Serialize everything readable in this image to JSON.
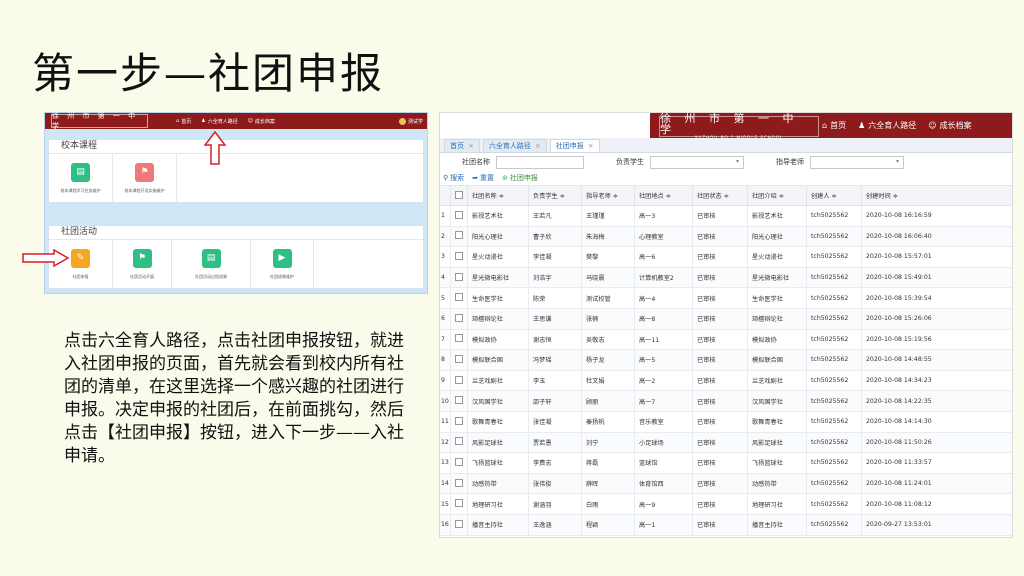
{
  "slide": {
    "title": "第一步—社团申报",
    "paragraph": "点击六全育人路径，点击社团申报按钮，就进入社团申报的页面，首先就会看到校内所有社团的清单，在这里选择一个感兴趣的社团进行申报。决定申报的社团后，在前面挑勾，然后点击【社团申报】按钮，进入下一步——入社申请。"
  },
  "left_screenshot": {
    "logo_text": "徐 州 市 第 一 中 学",
    "nav": {
      "home": "首页",
      "path": "六全育人路径",
      "growth": "成长档案"
    },
    "user": "测试学",
    "course_panel": {
      "title": "校本课程",
      "tiles": [
        {
          "label": "校本课程学习任务维护",
          "icon": "document-icon",
          "color": "#2fbf84"
        },
        {
          "label": "校本课程开设实施维护",
          "icon": "flag-icon",
          "color": "#f07878"
        }
      ]
    },
    "club_panel": {
      "title": "社团活动",
      "tiles": [
        {
          "label": "社团申报",
          "icon": "edit-icon",
          "color": "#f5a623"
        },
        {
          "label": "社团活动开展",
          "icon": "flag-icon",
          "color": "#2fbf84"
        },
        {
          "label": "社团活动过程成果",
          "icon": "document-icon",
          "color": "#2fbf84"
        },
        {
          "label": "社团成果维护",
          "icon": "play-icon",
          "color": "#2fbf84"
        }
      ]
    }
  },
  "right_screenshot": {
    "logo_text": "徐 州 市 第 一 中 学",
    "logo_sub": "XUZHOU NO.1 MIDDLE SCHOOL",
    "nav": {
      "home": "首页",
      "path": "六全育人路径",
      "growth": "成长档案"
    },
    "tabs": [
      {
        "label": "首页",
        "active": false
      },
      {
        "label": "六全育人路径",
        "active": false
      },
      {
        "label": "社团申报",
        "active": true
      }
    ],
    "filters": {
      "club_name": "社团名称",
      "student": "负责学生",
      "teacher": "指导老师"
    },
    "actions": {
      "search": "搜索",
      "reset": "重置",
      "apply": "社团申报"
    },
    "columns": [
      "社团名称 ≑",
      "负责学生 ≑",
      "指导老师 ≑",
      "社团地点 ≑",
      "社团状态 ≑",
      "社团介绍 ≑",
      "创建人 ≑",
      "创建时间 ≑"
    ],
    "rows": [
      [
        "1",
        "影视艺术社",
        "王若凡",
        "王瑾瑾",
        "高一3",
        "已审核",
        "影视艺术社",
        "tch5025562",
        "2020-10-08 16:16:59"
      ],
      [
        "2",
        "阳光心理社",
        "曹子欣",
        "朱海梅",
        "心理教室",
        "已审核",
        "阳光心理社",
        "tch5025562",
        "2020-10-08 16:06:40"
      ],
      [
        "3",
        "星火动漫社",
        "李佳凝",
        "樊黎",
        "高一6",
        "已审核",
        "星火动漫社",
        "tch5025562",
        "2020-10-08 15:57:01"
      ],
      [
        "4",
        "星光微电影社",
        "刘浩宇",
        "马晓晨",
        "计算机教室2",
        "已审核",
        "星光微电影社",
        "tch5025562",
        "2020-10-08 15:49:01"
      ],
      [
        "5",
        "生命医学社",
        "陈荣",
        "测试校管",
        "高一4",
        "已审核",
        "生命医学社",
        "tch5025562",
        "2020-10-08 15:39:54"
      ],
      [
        "6",
        "琦檀辩论社",
        "王思谦",
        "张楠",
        "高一8",
        "已审核",
        "琦檀辩论社",
        "tch5025562",
        "2020-10-08 15:26:06"
      ],
      [
        "7",
        "模拟政协",
        "谢志恒",
        "吴敬志",
        "高一11",
        "已审核",
        "模拟政协",
        "tch5025562",
        "2020-10-08 15:19:56"
      ],
      [
        "8",
        "模拟联合国",
        "冯梦瑶",
        "杨子龙",
        "高一5",
        "已审核",
        "模拟联合国",
        "tch5025562",
        "2020-10-08 14:48:55"
      ],
      [
        "9",
        "兰芝戏剧社",
        "李玉",
        "杜文娟",
        "高一2",
        "已审核",
        "兰芝戏剧社",
        "tch5025562",
        "2020-10-08 14:34:23"
      ],
      [
        "10",
        "汉风国学社",
        "邵子轩",
        "顾丽",
        "高一7",
        "已审核",
        "汉风国学社",
        "tch5025562",
        "2020-10-08 14:22:35"
      ],
      [
        "11",
        "歌舞青春社",
        "张佳凝",
        "秦扬帆",
        "音乐教室",
        "已审核",
        "歌舞青春社",
        "tch5025562",
        "2020-10-08 14:14:30"
      ],
      [
        "12",
        "风影足球社",
        "贾若愚",
        "刘宁",
        "小足球场",
        "已审核",
        "风影足球社",
        "tch5025562",
        "2020-10-08 11:50:26"
      ],
      [
        "13",
        "飞扬篮球社",
        "李费志",
        "蒋磊",
        "篮球馆",
        "已审核",
        "飞扬篮球社",
        "tch5025562",
        "2020-10-08 11:33:57"
      ],
      [
        "14",
        "动感热带",
        "张伟俊",
        "薛晖",
        "体育馆西",
        "已审核",
        "动感热带",
        "tch5025562",
        "2020-10-08 11:24:01"
      ],
      [
        "15",
        "地理研习社",
        "谢涵羽",
        "白雨",
        "高一9",
        "已审核",
        "地理研习社",
        "tch5025562",
        "2020-10-08 11:08:12"
      ],
      [
        "16",
        "播音主持社",
        "王逸涵",
        "程颖",
        "高一1",
        "已审核",
        "播音主持社",
        "tch5025562",
        "2020-09-27 13:53:01"
      ]
    ]
  },
  "colors": {
    "brand_red": "#8e1b1b",
    "arrow_red": "#d62020",
    "link_blue": "#2a6ebb",
    "background": "#fbfbeb"
  }
}
